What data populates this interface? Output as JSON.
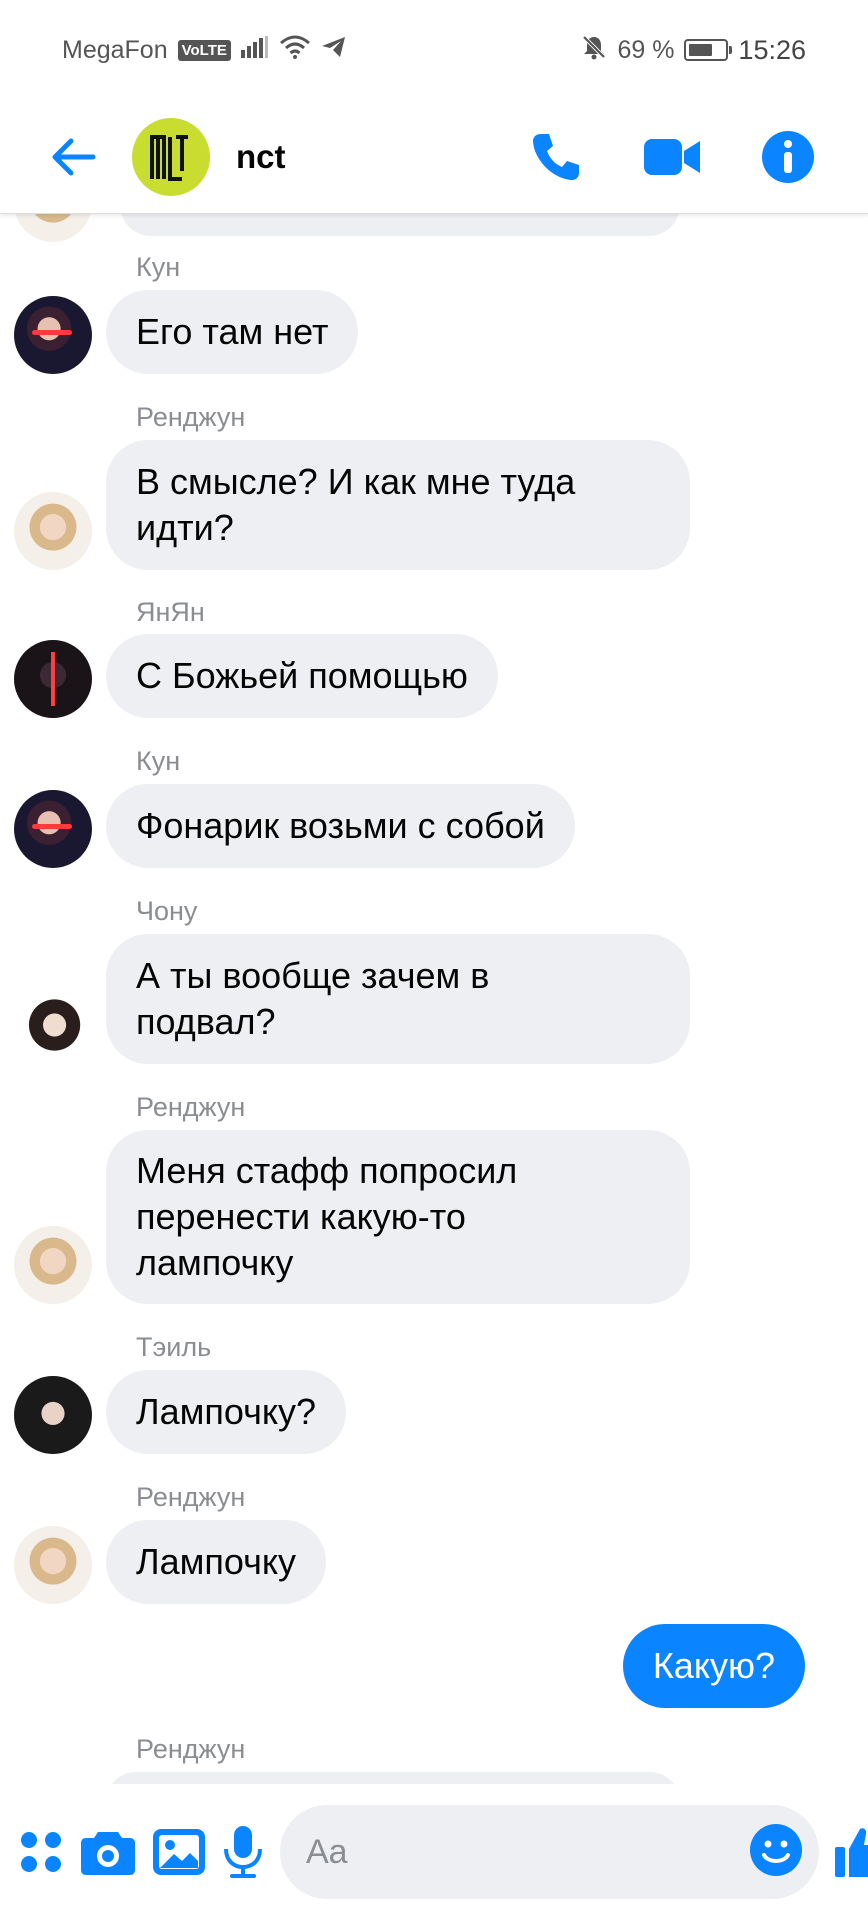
{
  "status_bar": {
    "carrier": "MegaFon",
    "network_badge": "VoLTE",
    "battery_percent": "69 %",
    "battery_level": 0.69,
    "time": "15:26"
  },
  "header": {
    "group_name": "nct",
    "back_icon": "arrow-left-icon",
    "call_icon": "phone-icon",
    "video_icon": "video-camera-icon",
    "info_icon": "info-icon"
  },
  "messages": [
    {
      "sender": "Кун",
      "text_lines": [
        "Его там нет"
      ],
      "avatar": "kun"
    },
    {
      "sender": "Ренджун",
      "text_lines": [
        "В смысле? И как мне туда",
        "идти?"
      ],
      "avatar": "renjun"
    },
    {
      "sender": "ЯнЯн",
      "text_lines": [
        "С Божьей помощью"
      ],
      "avatar": "yangyang"
    },
    {
      "sender": "Кун",
      "text_lines": [
        "Фонарик возьми с собой"
      ],
      "avatar": "kun"
    },
    {
      "sender": "Чону",
      "text_lines": [
        "А ты вообще зачем в",
        "подвал?"
      ],
      "avatar": "chonu"
    },
    {
      "sender": "Ренджун",
      "text_lines": [
        "Меня стафф попросил",
        "перенести какую-то",
        "лампочку"
      ],
      "avatar": "renjun"
    },
    {
      "sender": "Тэиль",
      "text_lines": [
        "Лампочку?"
      ],
      "avatar": "taeil"
    },
    {
      "sender": "Ренджун",
      "text_lines": [
        "Лампочку"
      ],
      "avatar": "renjun"
    }
  ],
  "own_message": {
    "text": "Какую?"
  },
  "next_sender": "Ренджун",
  "composer": {
    "placeholder": "Aa",
    "icons": [
      "menu-dots-icon",
      "camera-icon",
      "image-icon",
      "microphone-icon",
      "emoji-icon",
      "thumbs-up-icon"
    ]
  },
  "colors": {
    "accent": "#0a85ff",
    "bubble_incoming": "#eeeff2",
    "group_avatar": "#c9dc30"
  }
}
